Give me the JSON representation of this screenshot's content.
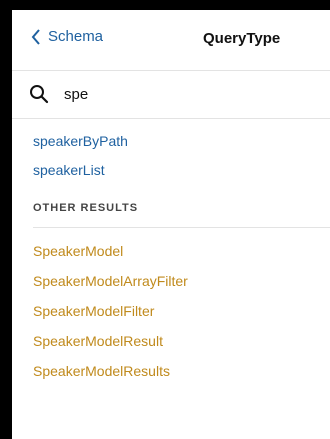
{
  "header": {
    "back_label": "Schema",
    "title": "QueryType"
  },
  "search": {
    "value": "spe",
    "icon": "search-icon"
  },
  "results": {
    "fields": [
      "speakerByPath",
      "speakerList"
    ],
    "other_heading": "OTHER RESULTS",
    "types": [
      "SpeakerModel",
      "SpeakerModelArrayFilter",
      "SpeakerModelFilter",
      "SpeakerModelResult",
      "SpeakerModelResults"
    ]
  },
  "colors": {
    "field_link": "#1f61a0",
    "type_link": "#c08a1c",
    "background": "#000000"
  }
}
